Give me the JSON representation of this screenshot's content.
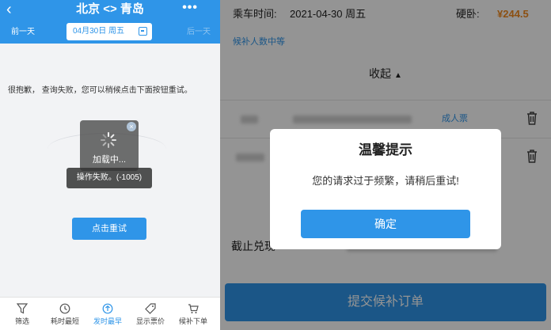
{
  "left": {
    "header": {
      "back_glyph": "‹",
      "route": "北京 <> 青岛",
      "more_glyph": "•••",
      "prev_day": "前一天",
      "date": "04月30日 周五",
      "next_day": "后一天"
    },
    "error_message": "很抱歉， 查询失败，您可以稍候点击下面按钮重试。",
    "loading": {
      "close_glyph": "×",
      "text": "加载中..."
    },
    "toast": "操作失败。(-1005)",
    "retry_label": "点击重试",
    "tabs": [
      {
        "label": "筛选",
        "icon": "filter-icon"
      },
      {
        "label": "耗时最短",
        "icon": "clock-icon"
      },
      {
        "label": "发时最早",
        "icon": "clock-arrow-icon"
      },
      {
        "label": "显示票价",
        "icon": "price-tag-icon"
      },
      {
        "label": "候补下单",
        "icon": "cart-icon"
      }
    ],
    "active_tab": 2
  },
  "right": {
    "departure_label": "乘车时间:",
    "departure_date": "2021-04-30 周五",
    "seat_type": "硬卧:",
    "price": "¥244.5",
    "waitlist_status": "候补人数中等",
    "collapse_label": "收起",
    "collapse_caret": "▲",
    "passenger_type": "成人票",
    "deadline_label": "截止兑现",
    "submit_label": "提交候补订单",
    "dialog": {
      "title": "温馨提示",
      "message": "您的请求过于频繁，请稍后重试!",
      "ok_label": "确定"
    }
  },
  "colors": {
    "primary": "#2f95e8",
    "price": "#f28b20",
    "overlay": "rgba(0,0,0,0.42)"
  }
}
